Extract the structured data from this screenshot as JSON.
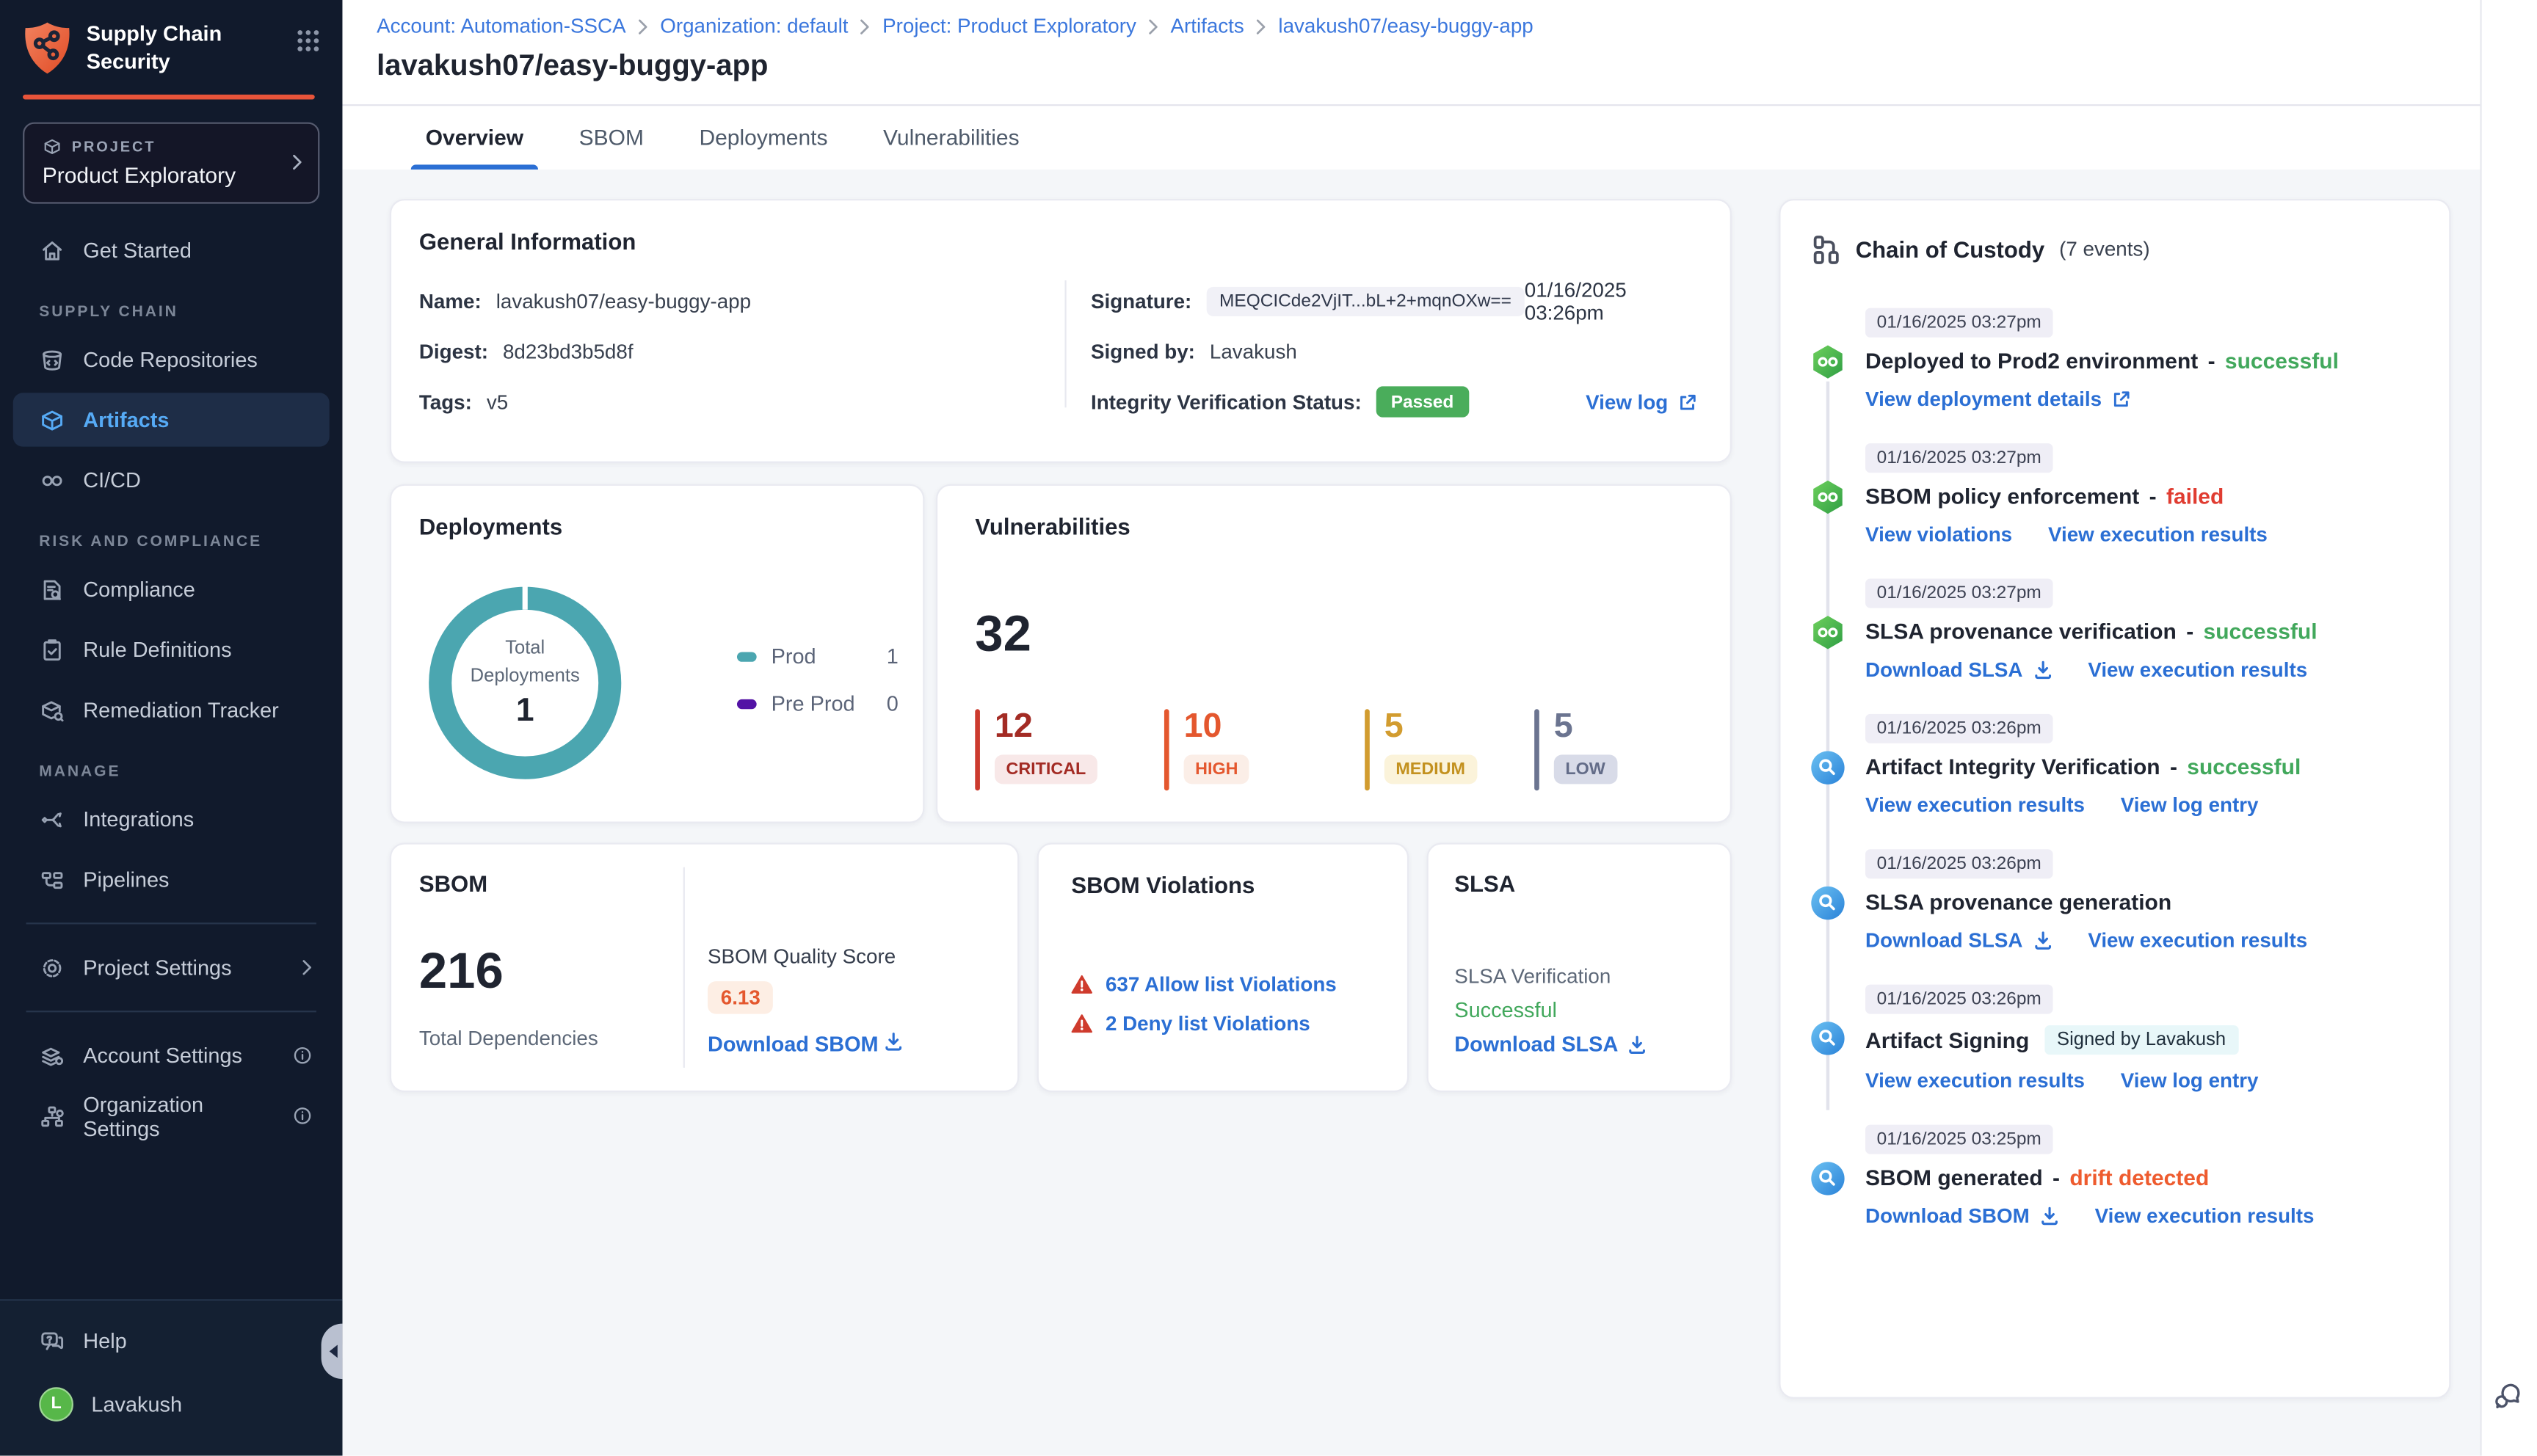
{
  "colors": {
    "sidebar_bg": "#111a2c",
    "module_accent": "#e8543a",
    "active_nav_blue": "#56aaf5",
    "link_blue": "#2b6fd4",
    "breadcrumb_blue": "#3b77dd",
    "success_green": "#42a85c",
    "failed_red": "#e03c31",
    "drift_orange": "#ee5b2e",
    "passed_badge_green": "#4aad5b",
    "quality_score_orange": "#e4572e",
    "critical": "#a32b24",
    "high": "#e4572e",
    "medium": "#d29c2f",
    "low": "#6b7490",
    "donut_teal": "#4ba6b0",
    "preprod_purple": "#5313a5",
    "avatar_green": "#57b749"
  },
  "sidebar": {
    "app_title": "Supply Chain Security",
    "project_label": "PROJECT",
    "project_name": "Product Exploratory",
    "nav": {
      "get_started": "Get Started",
      "section_supply_chain": "SUPPLY CHAIN",
      "code_repositories": "Code Repositories",
      "artifacts": "Artifacts",
      "cicd": "CI/CD",
      "section_risk_compliance": "RISK AND COMPLIANCE",
      "compliance": "Compliance",
      "rule_definitions": "Rule Definitions",
      "remediation_tracker": "Remediation Tracker",
      "section_manage": "MANAGE",
      "integrations": "Integrations",
      "pipelines": "Pipelines",
      "project_settings": "Project Settings",
      "account_settings": "Account Settings",
      "organization_settings": "Organization Settings"
    },
    "help": "Help",
    "user": {
      "name": "Lavakush",
      "initial": "L"
    }
  },
  "header": {
    "breadcrumb": [
      "Account: Automation-SSCA",
      "Organization: default",
      "Project: Product Exploratory",
      "Artifacts",
      "lavakush07/easy-buggy-app"
    ],
    "title": "lavakush07/easy-buggy-app",
    "tabs": [
      "Overview",
      "SBOM",
      "Deployments",
      "Vulnerabilities"
    ],
    "active_tab": "Overview"
  },
  "general_info": {
    "title": "General Information",
    "name_label": "Name:",
    "name_value": "lavakush07/easy-buggy-app",
    "digest_label": "Digest:",
    "digest_value": "8d23bd3b5d8f",
    "tags_label": "Tags:",
    "tags_value": "v5",
    "signature_label": "Signature:",
    "signature_value": "MEQCICde2VjIT...bL+2+mqnOXw==",
    "signature_time": "01/16/2025 03:26pm",
    "signed_by_label": "Signed by:",
    "signed_by_value": "Lavakush",
    "integrity_label": "Integrity Verification Status:",
    "integrity_status": "Passed",
    "view_log": "View log"
  },
  "deployments": {
    "title": "Deployments",
    "center_top": "Total",
    "center_bottom": "Deployments",
    "total": "1",
    "legend": [
      {
        "label": "Prod",
        "value": "1"
      },
      {
        "label": "Pre Prod",
        "value": "0"
      }
    ],
    "chart_data": {
      "type": "pie",
      "categories": [
        "Prod",
        "Pre Prod"
      ],
      "values": [
        1,
        0
      ],
      "title": "Total Deployments",
      "colors": [
        "#4ba6b0",
        "#5313a5"
      ]
    }
  },
  "vulnerabilities": {
    "title": "Vulnerabilities",
    "total": "32",
    "severities": [
      {
        "label": "CRITICAL",
        "value": "12"
      },
      {
        "label": "HIGH",
        "value": "10"
      },
      {
        "label": "MEDIUM",
        "value": "5"
      },
      {
        "label": "LOW",
        "value": "5"
      }
    ],
    "chart_data": {
      "type": "bar",
      "categories": [
        "CRITICAL",
        "HIGH",
        "MEDIUM",
        "LOW"
      ],
      "values": [
        12,
        10,
        5,
        5
      ],
      "title": "Vulnerabilities",
      "total": 32
    }
  },
  "sbom": {
    "title": "SBOM",
    "total": "216",
    "total_label": "Total Dependencies",
    "quality_label": "SBOM Quality Score",
    "quality_score": "6.13",
    "download": "Download SBOM"
  },
  "sbom_violations": {
    "title": "SBOM Violations",
    "allow": "637 Allow list Violations",
    "deny": "2 Deny list Violations"
  },
  "slsa": {
    "title": "SLSA",
    "verification_label": "SLSA Verification",
    "status": "Successful",
    "download": "Download SLSA"
  },
  "custody": {
    "title": "Chain of Custody",
    "count": "(7 events)",
    "separator": "-",
    "events": [
      {
        "time": "01/16/2025 03:27pm",
        "title": "Deployed to Prod2 environment",
        "status": "successful",
        "links": [
          {
            "label": "View deployment details",
            "icon": "external-link"
          }
        ]
      },
      {
        "time": "01/16/2025 03:27pm",
        "title": "SBOM policy enforcement",
        "status": "failed",
        "links": [
          {
            "label": "View violations"
          },
          {
            "label": "View execution results"
          }
        ]
      },
      {
        "time": "01/16/2025 03:27pm",
        "title": "SLSA provenance verification",
        "status": "successful",
        "links": [
          {
            "label": "Download SLSA",
            "icon": "download"
          },
          {
            "label": "View execution results"
          }
        ]
      },
      {
        "time": "01/16/2025 03:26pm",
        "title": "Artifact Integrity Verification",
        "status": "successful",
        "links": [
          {
            "label": "View execution results"
          },
          {
            "label": "View log entry"
          }
        ]
      },
      {
        "time": "01/16/2025 03:26pm",
        "title": "SLSA provenance generation",
        "status": "",
        "links": [
          {
            "label": "Download SLSA",
            "icon": "download"
          },
          {
            "label": "View execution results"
          }
        ]
      },
      {
        "time": "01/16/2025 03:26pm",
        "title": "Artifact Signing",
        "badge": "Signed by Lavakush",
        "links": [
          {
            "label": "View execution results"
          },
          {
            "label": "View log entry"
          }
        ]
      },
      {
        "time": "01/16/2025 03:25pm",
        "title": "SBOM generated",
        "status": "drift detected",
        "links": [
          {
            "label": "Download SBOM",
            "icon": "download"
          },
          {
            "label": "View execution results"
          }
        ]
      }
    ]
  }
}
